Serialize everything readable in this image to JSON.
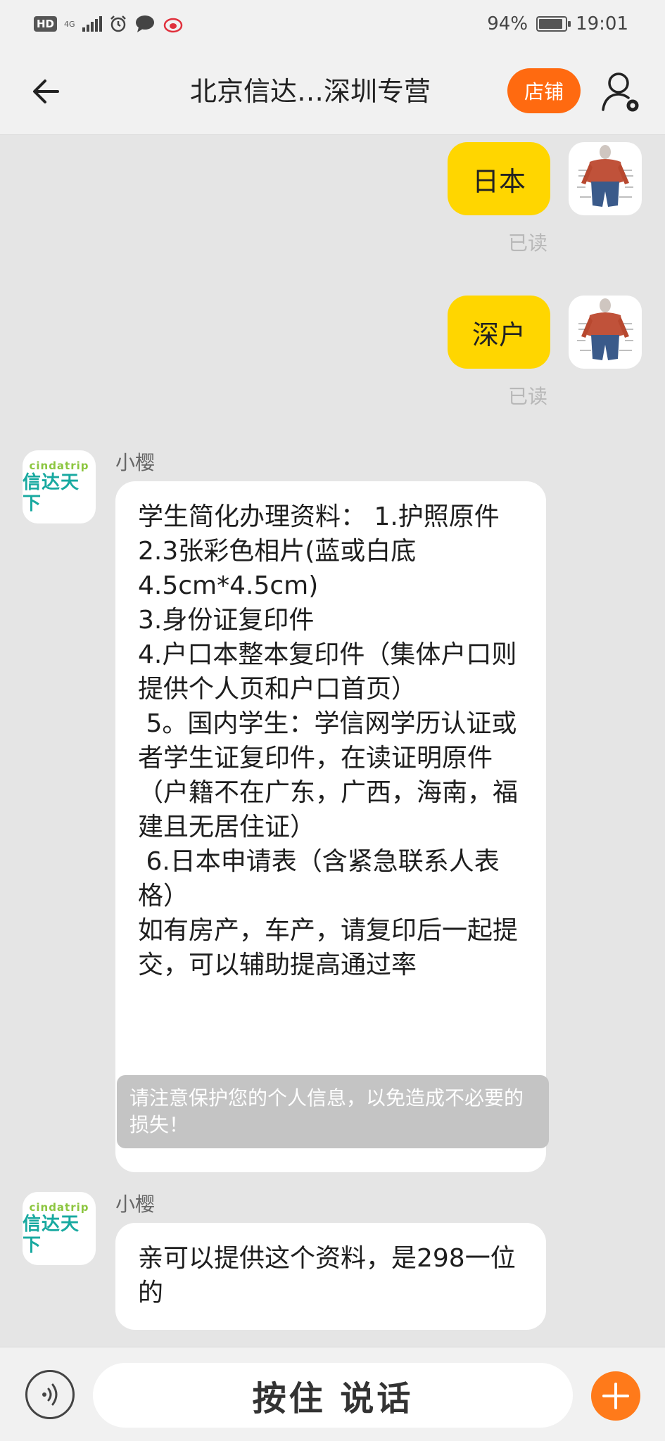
{
  "status_bar": {
    "hd": "HD",
    "network": "4G",
    "battery_pct": "94%",
    "battery_level": 0.94,
    "time": "19:01"
  },
  "header": {
    "title": "北京信达…深圳专营",
    "store_label": "店铺"
  },
  "messages": {
    "me1": {
      "text": "日本",
      "status": "已读"
    },
    "me2": {
      "text": "深户",
      "status": "已读"
    },
    "shop1": {
      "sender": "小樱",
      "text": "学生简化办理资料： 1.护照原件\n2.3张彩色相片(蓝或白底 4.5cm*4.5cm)\n3.身份证复印件\n4.户口本整本复印件（集体户口则提供个人页和户口首页）\n 5。国内学生：学信网学历认证或者学生证复印件，在读证明原件（户籍不在广东，广西，海南，福建且无居住证）\n 6.日本申请表（含紧急联系人表格）\n如有房产，车产，请复印后一起提交，可以辅助提高通过率"
    },
    "notice": "请注意保护您的个人信息，以免造成不必要的损失！",
    "shop2": {
      "sender": "小樱",
      "text": "亲可以提供这个资料，是298一位的"
    }
  },
  "shop_avatar": {
    "en": "cindatrip",
    "cn": "信达天下"
  },
  "input_bar": {
    "talk_label": "按住 说话"
  },
  "colors": {
    "accent": "#ff6a10",
    "my_bubble": "#ffd600",
    "logo_green": "#8cc63f",
    "logo_teal": "#18a9a0"
  }
}
